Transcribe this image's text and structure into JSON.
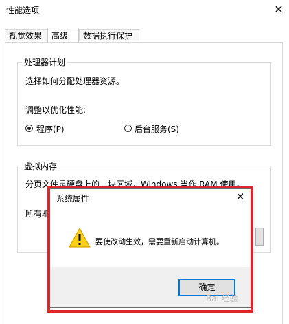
{
  "window": {
    "title": "性能选项"
  },
  "tabs": [
    {
      "label": "视觉效果"
    },
    {
      "label": "高级"
    },
    {
      "label": "数据执行保护"
    }
  ],
  "processor_group": {
    "title": "处理器计划",
    "description": "选择如何分配处理器资源。",
    "adjust_label": "调整以优化性能:",
    "options": [
      {
        "label": "程序(P)",
        "selected": true
      },
      {
        "label": "后台服务(S)",
        "selected": false
      }
    ]
  },
  "virtual_memory_group": {
    "title": "虚拟内存",
    "description": "分页文件是硬盘上的一块区域，Windows 当作 RAM 使用。",
    "partial_label": "所有驱"
  },
  "dialog": {
    "title": "系统属性",
    "message": "要使改动生效，需要重新启动计算机。",
    "ok_label": "确定",
    "icon": "warning-icon"
  },
  "highlight_color": "#e1232c",
  "watermark": "Bai 经验"
}
